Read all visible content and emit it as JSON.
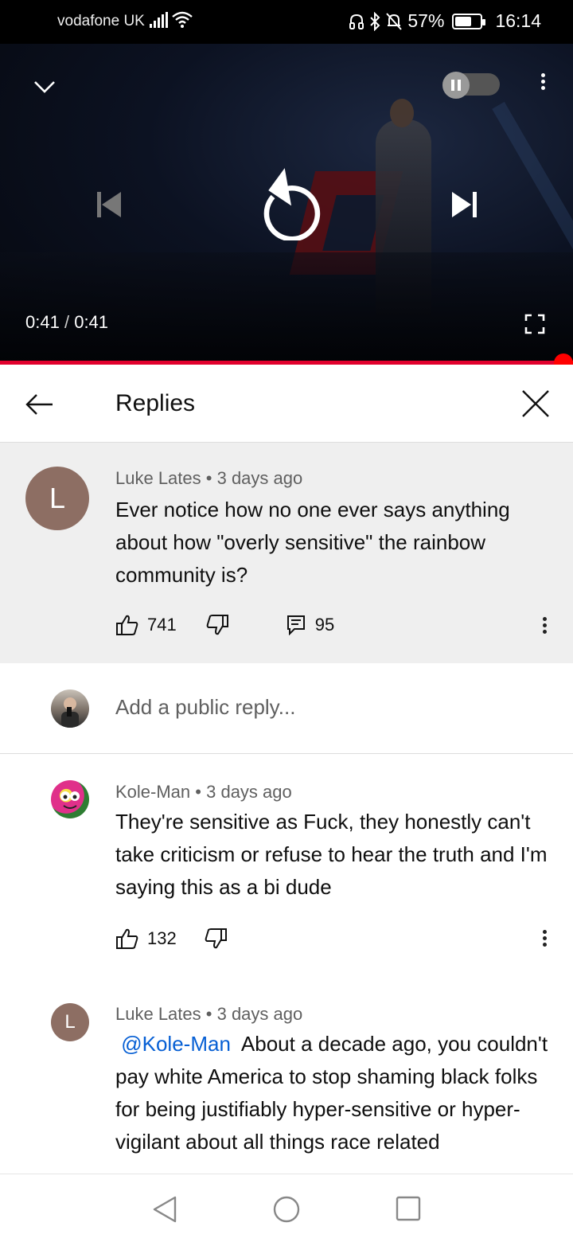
{
  "status_bar": {
    "carrier": "vodafone UK",
    "battery": "57%",
    "battery_level": 0.57,
    "time": "16:14"
  },
  "player": {
    "current_time": "0:41",
    "separator": "/",
    "duration": "0:41",
    "progress": 1.0,
    "icons": [
      "chevron-down-icon",
      "autoplay-toggle",
      "more-vert-icon",
      "previous-icon",
      "replay-icon",
      "next-icon",
      "fullscreen-icon"
    ]
  },
  "replies_header": {
    "title": "Replies"
  },
  "parent_comment": {
    "avatar_letter": "L",
    "author": "Luke Lates",
    "dot": "•",
    "age": "3 days ago",
    "text": "Ever notice how no one ever says anything about how \"overly sensitive\" the rainbow community is?",
    "likes": "741",
    "replies": "95",
    "avatar_color": "#8d6e63"
  },
  "add_reply": {
    "placeholder": "Add a public reply..."
  },
  "replies": [
    {
      "author": "Kole-Man",
      "dot": "•",
      "age": "3 days ago",
      "text": "They're sensitive as Fuck, they honestly can't take criticism or refuse to hear the truth and I'm saying this as a bi dude",
      "likes": "132"
    },
    {
      "avatar_letter": "L",
      "author": "Luke Lates",
      "dot": "•",
      "age": "3 days ago",
      "mention": "@Kole-Man",
      "text": "About a decade ago, you couldn't pay white America to stop shaming black folks for being justifiably hyper-sensitive or hyper-vigilant about all things race related",
      "avatar_color": "#8d6e63"
    }
  ],
  "colors": {
    "accent_red": "#ff0000",
    "mention_blue": "#065fd4"
  }
}
